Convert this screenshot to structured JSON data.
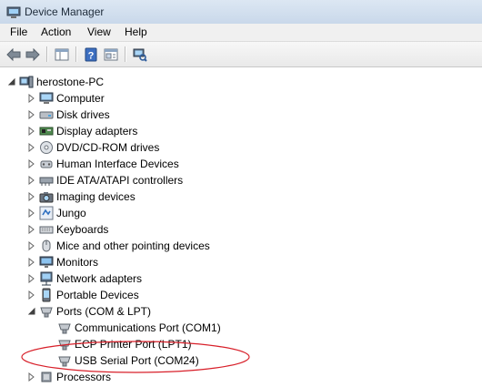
{
  "window": {
    "title": "Device Manager"
  },
  "menu": [
    "File",
    "Action",
    "View",
    "Help"
  ],
  "toolbar": {
    "buttons": [
      "back-icon",
      "forward-icon",
      "show-hide-console-tree-icon",
      "help-icon",
      "properties-icon",
      "scan-hardware-icon"
    ]
  },
  "tree": {
    "root": "herostone-PC",
    "categories": [
      {
        "label": "Computer",
        "icon": "computer-icon"
      },
      {
        "label": "Disk drives",
        "icon": "disk-drive-icon"
      },
      {
        "label": "Display adapters",
        "icon": "display-adapter-icon"
      },
      {
        "label": "DVD/CD-ROM drives",
        "icon": "dvd-drive-icon"
      },
      {
        "label": "Human Interface Devices",
        "icon": "hid-icon"
      },
      {
        "label": "IDE ATA/ATAPI controllers",
        "icon": "ide-controller-icon"
      },
      {
        "label": "Imaging devices",
        "icon": "camera-icon"
      },
      {
        "label": "Jungo",
        "icon": "jungo-icon"
      },
      {
        "label": "Keyboards",
        "icon": "keyboard-icon"
      },
      {
        "label": "Mice and other pointing devices",
        "icon": "mouse-icon"
      },
      {
        "label": "Monitors",
        "icon": "monitor-icon"
      },
      {
        "label": "Network adapters",
        "icon": "network-adapter-icon"
      },
      {
        "label": "Portable Devices",
        "icon": "portable-device-icon"
      },
      {
        "label": "Ports (COM & LPT)",
        "icon": "port-icon",
        "expanded": true
      },
      {
        "label": "Processors",
        "icon": "processor-icon"
      }
    ],
    "ports": [
      "Communications Port (COM1)",
      "ECP Printer Port (LPT1)",
      "USB Serial Port (COM24)"
    ]
  },
  "annotation": {
    "highlighted_item": "USB Serial Port (COM24)",
    "color": "#d8202a"
  }
}
